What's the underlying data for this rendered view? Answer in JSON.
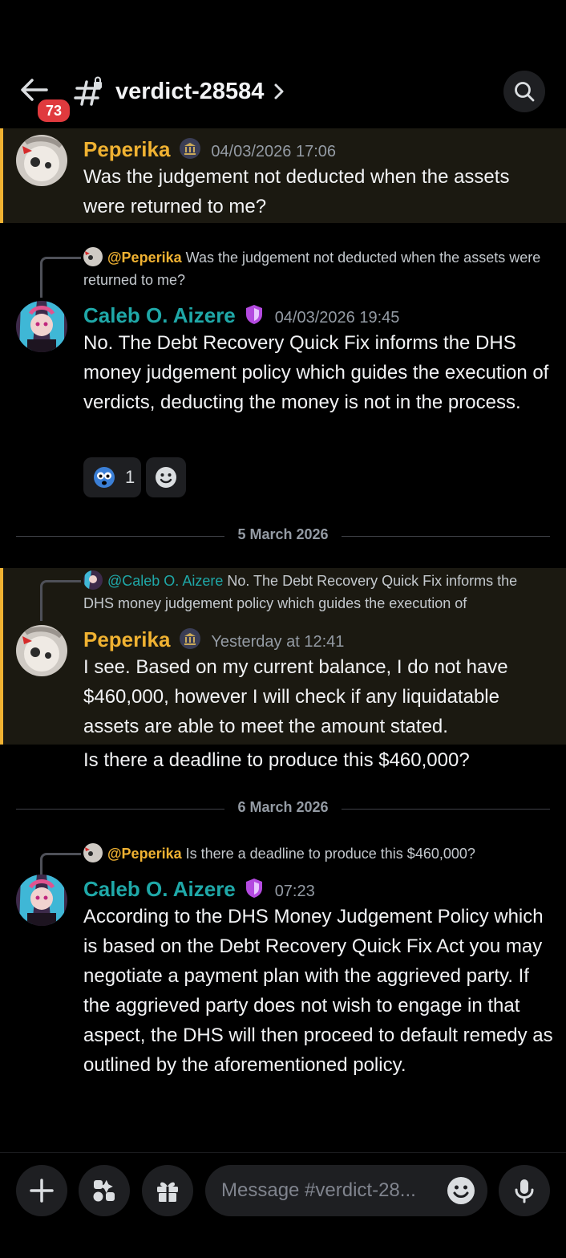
{
  "header": {
    "back_badge": "73",
    "channel_name": "verdict-28584"
  },
  "messages": [
    {
      "author": "Peperika",
      "timestamp": "04/03/2026 17:06",
      "text": "Was the judgement not deducted when the assets were returned to me?"
    },
    {
      "reply_mention": "@Peperika",
      "reply_text": "Was the judgement not deducted when the assets were returned to me?",
      "author": "Caleb O. Aizere",
      "timestamp": "04/03/2026 19:45",
      "text": "No. The Debt Recovery Quick Fix informs the DHS money judgement policy which guides the execution of verdicts, deducting the money is not in the process.",
      "reaction_count": "1"
    },
    {
      "reply_mention": "@Caleb O. Aizere",
      "reply_text": "No. The Debt Recovery Quick Fix informs the DHS money judgement policy which guides the execution of",
      "author": "Peperika",
      "timestamp": "Yesterday at 12:41",
      "text": "I see. Based on my current balance, I do not have $460,000, however I will check if any liquidatable assets are able to meet the amount stated.",
      "followup": "Is there a deadline to produce this $460,000?"
    },
    {
      "reply_mention": "@Peperika",
      "reply_text": "Is there a deadline to produce this $460,000?",
      "author": "Caleb O. Aizere",
      "timestamp": "07:23",
      "text": "According to the DHS Money Judgement Policy which is based on the Debt Recovery Quick Fix Act you may negotiate a payment plan with the aggrieved party. If the aggrieved party does not wish to engage in that aspect, the DHS will then proceed to default remedy as outlined by the aforementioned policy."
    }
  ],
  "dividers": [
    "5 March 2026",
    "6 March 2026"
  ],
  "composer": {
    "placeholder": "Message #verdict-28..."
  },
  "colors": {
    "peperika": "#f0b232",
    "caleb": "#1fa8a8",
    "highlight_border": "#f0b232",
    "badge": "#e03a3e"
  },
  "icons": [
    "back-arrow-icon",
    "hash-lock-icon",
    "chevron-right-icon",
    "search-icon",
    "bank-badge-icon",
    "shield-role-icon",
    "plus-icon",
    "apps-icon",
    "gift-icon",
    "emoji-icon",
    "microphone-icon"
  ]
}
